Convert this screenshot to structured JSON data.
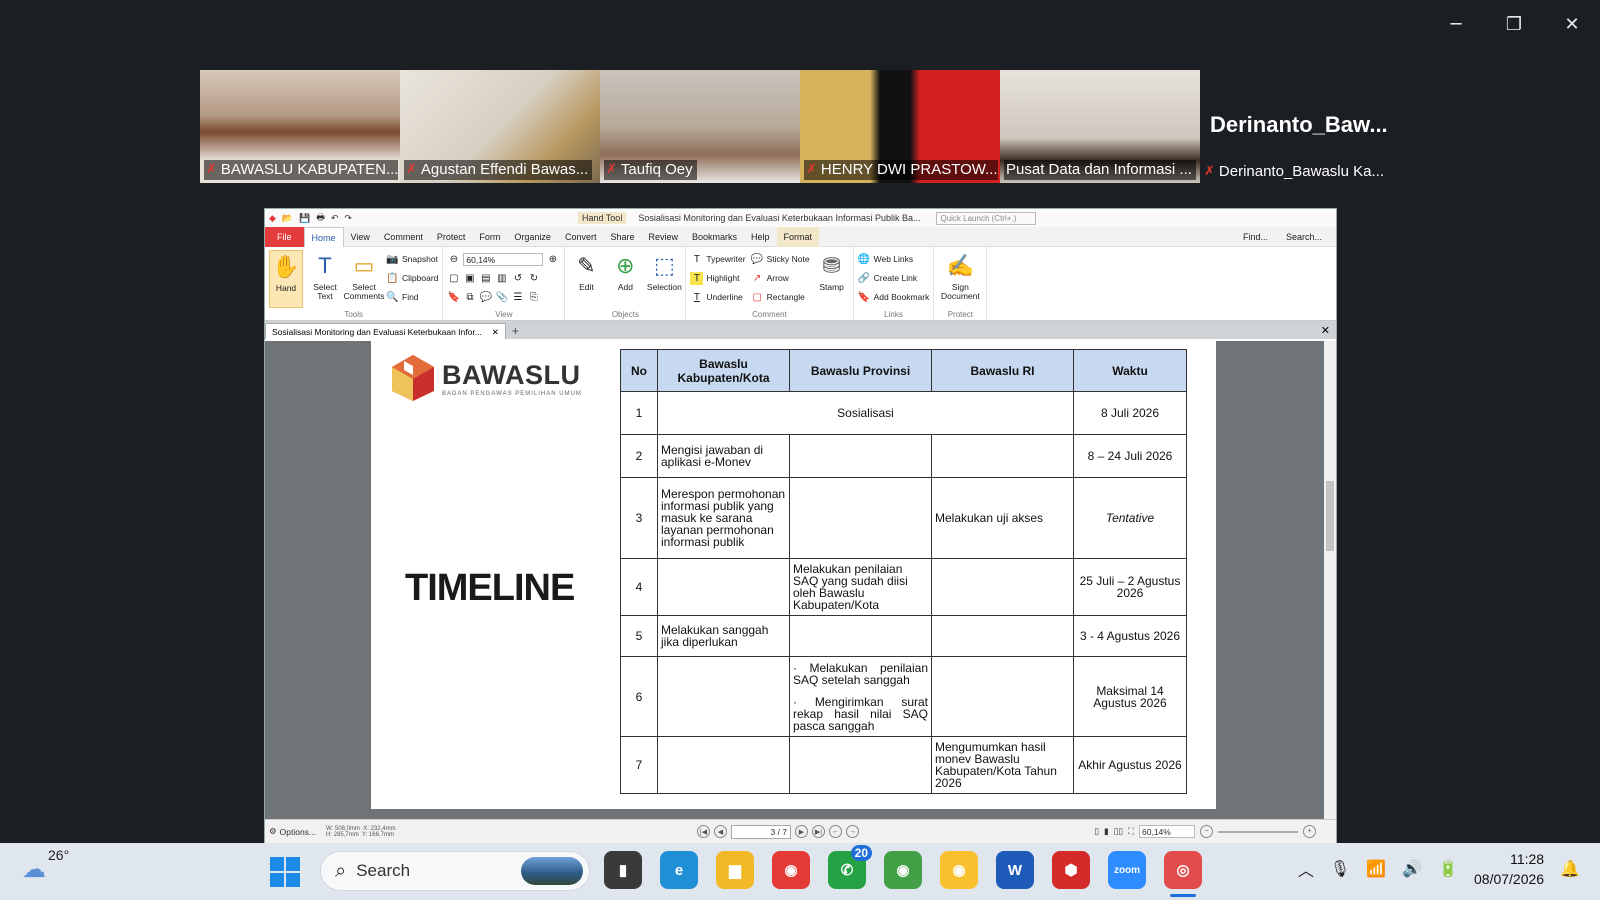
{
  "window": {
    "min": "─",
    "max": "❐",
    "close": "✕"
  },
  "participants": [
    {
      "name": "BAWASLU KABUPATEN...",
      "bg": "linear-gradient(180deg,#d8c9b9 0%,#b49a84 40%,#7b4b2f 55%,#e8e1d8 80%)",
      "active": false
    },
    {
      "name": "Agustan Effendi Bawas...",
      "bg": "linear-gradient(135deg,#eae5dc 0%,#d7cfc3 50%,#b99a60 75%,#7c6a4f 100%)",
      "active": false
    },
    {
      "name": "Taufiq Oey",
      "bg": "linear-gradient(180deg,#c9c3bc 0%,#b7aa9a 50%,#8f6e57 75%,#e9e7e4 100%)",
      "active": false
    },
    {
      "name": "HENRY DWI PRASTOW...",
      "bg": "linear-gradient(90deg,#d7b25c 0%,#d7b25c 35%,#111 40%,#111 55%,#d32121 60%,#d32121 100%)",
      "active": false
    },
    {
      "name": "Pusat Data dan Informasi ...",
      "bg": "linear-gradient(180deg,#e6e2dc 0%,#cfc7bd 60%,#3b2c22 80%,#cfc7bd 100%)",
      "active": true
    }
  ],
  "name_tile": {
    "big": "Derinanto_Baw...",
    "label": "Derinanto_Bawaslu Ka..."
  },
  "foxit": {
    "qat_hand_tool": "Hand Tool",
    "doc_title": "Sosialisasi Monitoring dan Evaluasi Keterbukaan Informasi Publik Ba...",
    "quick_launch": "Quick Launch (Ctrl+.)",
    "tabs": [
      "Home",
      "View",
      "Comment",
      "Protect",
      "Form",
      "Organize",
      "Convert",
      "Share",
      "Review",
      "Bookmarks",
      "Help"
    ],
    "file_tab": "File",
    "format_tab": "Format",
    "find": "Find...",
    "search": "Search...",
    "tools": {
      "hand": "Hand",
      "select_text": "Select Text",
      "select_comments": "Select Comments",
      "snapshot": "Snapshot",
      "clipboard": "Clipboard",
      "find": "Find",
      "group": "Tools"
    },
    "view": {
      "zoom": "60,14%",
      "group": "View"
    },
    "objects": {
      "edit": "Edit",
      "add": "Add",
      "selection": "Selection",
      "group": "Objects"
    },
    "comment": {
      "typewriter": "Typewriter",
      "highlight": "Highlight",
      "underline": "Underline",
      "sticky": "Sticky Note",
      "arrow": "Arrow",
      "rectangle": "Rectangle",
      "stamp": "Stamp",
      "group": "Comment"
    },
    "links": {
      "web": "Web Links",
      "create": "Create Link",
      "bookmark": "Add Bookmark",
      "group": "Links"
    },
    "protect": {
      "sign": "Sign Document",
      "group": "Protect"
    },
    "doc_tab": "Sosialisasi Monitoring dan Evaluasi Keterbukaan Infor...",
    "status": {
      "options": "Options...",
      "dims": "W: 508,0mm  X: 232,4mm\nH: 285,7mm  Y: 166,7mm",
      "page": "3 / 7",
      "zoom": "60,14%"
    }
  },
  "slide": {
    "logo_name": "BAWASLU",
    "logo_sub": "BADAN PENGAWAS PEMILIHAN UMUM",
    "title": "TIMELINE",
    "headers": [
      "No",
      "Bawaslu Kabupaten/Kota",
      "Bawaslu Provinsi",
      "Bawaslu RI",
      "Waktu"
    ],
    "rows": [
      {
        "no": "1",
        "merged": "Sosialisasi",
        "waktu": "8 Juli 2026"
      },
      {
        "no": "2",
        "kab": "Mengisi jawaban di aplikasi e-Monev",
        "prov": "",
        "ri": "",
        "waktu": "8 – 24 Juli 2026"
      },
      {
        "no": "3",
        "kab": "Merespon permohonan informasi publik yang masuk ke sarana layanan permohonan informasi publik",
        "prov": "",
        "ri": "Melakukan uji akses",
        "waktu": "Tentative"
      },
      {
        "no": "4",
        "kab": "",
        "prov": "Melakukan penilaian SAQ yang sudah diisi oleh Bawaslu Kabupaten/Kota",
        "ri": "",
        "waktu": "25 Juli – 2 Agustus 2026"
      },
      {
        "no": "5",
        "kab": "Melakukan sanggah jika diperlukan",
        "prov": "",
        "ri": "",
        "waktu": "3 - 4 Agustus 2026"
      },
      {
        "no": "6",
        "kab": "",
        "prov_a": "· Melakukan penilaian SAQ setelah sanggah",
        "prov_b": "· Mengirimkan surat rekap hasil nilai SAQ pasca sanggah",
        "ri": "",
        "waktu": "Maksimal 14 Agustus 2026"
      },
      {
        "no": "7",
        "kab": "",
        "prov": "",
        "ri": "Mengumumkan hasil monev Bawaslu Kabupaten/Kota Tahun 2026",
        "waktu": "Akhir Agustus 2026"
      }
    ]
  },
  "taskbar": {
    "temp": "26°",
    "search": "Search",
    "whatsapp_badge": "20",
    "time": "11:28",
    "date": "08/07/2026",
    "apps": [
      {
        "name": "task-view",
        "glyph": "▮",
        "bg": "#3a3a3a"
      },
      {
        "name": "edge",
        "glyph": "e",
        "bg": "#1f8fd6"
      },
      {
        "name": "file-explorer",
        "glyph": "▆",
        "bg": "#f2b825"
      },
      {
        "name": "chrome",
        "glyph": "◉",
        "bg": "#e53935"
      },
      {
        "name": "whatsapp",
        "glyph": "✆",
        "bg": "#25a244"
      },
      {
        "name": "chrome-profile-1",
        "glyph": "◉",
        "bg": "#43a047"
      },
      {
        "name": "chrome-profile-2",
        "glyph": "◉",
        "bg": "#fbc02d"
      },
      {
        "name": "word",
        "glyph": "W",
        "bg": "#1e5bb8"
      },
      {
        "name": "pdf-reader",
        "glyph": "⬢",
        "bg": "#d42a2a"
      },
      {
        "name": "zoom",
        "glyph": "zoom",
        "bg": "#2d8cff"
      },
      {
        "name": "recorder",
        "glyph": "◎",
        "bg": "#e24b4b"
      }
    ]
  }
}
